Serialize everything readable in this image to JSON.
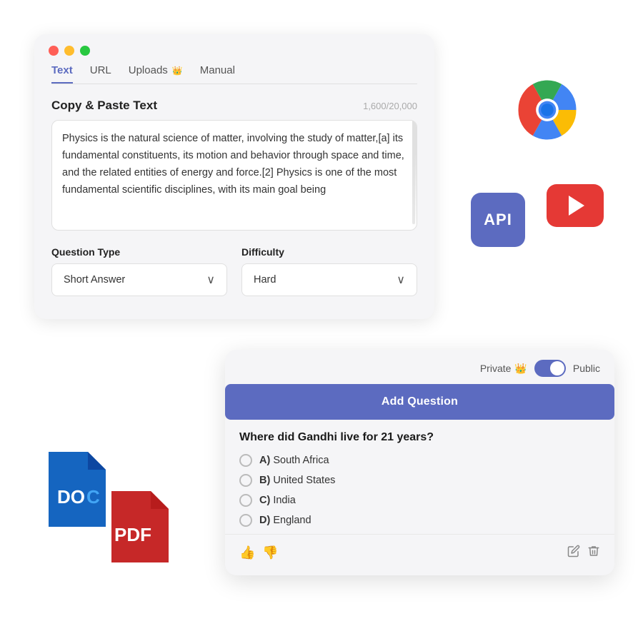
{
  "back_card": {
    "tabs": [
      {
        "label": "Text",
        "active": true,
        "crown": false
      },
      {
        "label": "URL",
        "active": false,
        "crown": false
      },
      {
        "label": "Uploads",
        "active": false,
        "crown": true
      },
      {
        "label": "Manual",
        "active": false,
        "crown": false
      }
    ],
    "section_title": "Copy & Paste Text",
    "char_count": "1,600/20,000",
    "text_content": "Physics is the natural science of matter, involving the study of matter,[a] its fundamental constituents, its motion and behavior through  space and time, and the related entities of energy and force.[2] Physics is one of the most fundamental scientific disciplines, with its main goal being",
    "question_type_label": "Question Type",
    "question_type_value": "Short Answer",
    "difficulty_label": "Difficulty",
    "difficulty_value": "Hard"
  },
  "front_card": {
    "toggle_private": "Private",
    "toggle_public": "Public",
    "add_question_label": "Add Question",
    "question": "Where did Gandhi live for 21 years?",
    "options": [
      {
        "key": "A)",
        "text": "South Africa"
      },
      {
        "key": "B)",
        "text": "United States"
      },
      {
        "key": "C)",
        "text": "India"
      },
      {
        "key": "D)",
        "text": "England"
      }
    ]
  },
  "badges": {
    "api_text": "API",
    "doc_text": "DOC",
    "pdf_text": "PDF"
  },
  "icons": {
    "chevron": "∨",
    "thumbup": "👍",
    "thumbdown": "👎",
    "edit": "✎",
    "trash": "🗑",
    "crown": "👑"
  },
  "colors": {
    "accent": "#5c6bc0",
    "danger": "#e53935",
    "doc_blue": "#1565c0",
    "pdf_red": "#c62828"
  }
}
